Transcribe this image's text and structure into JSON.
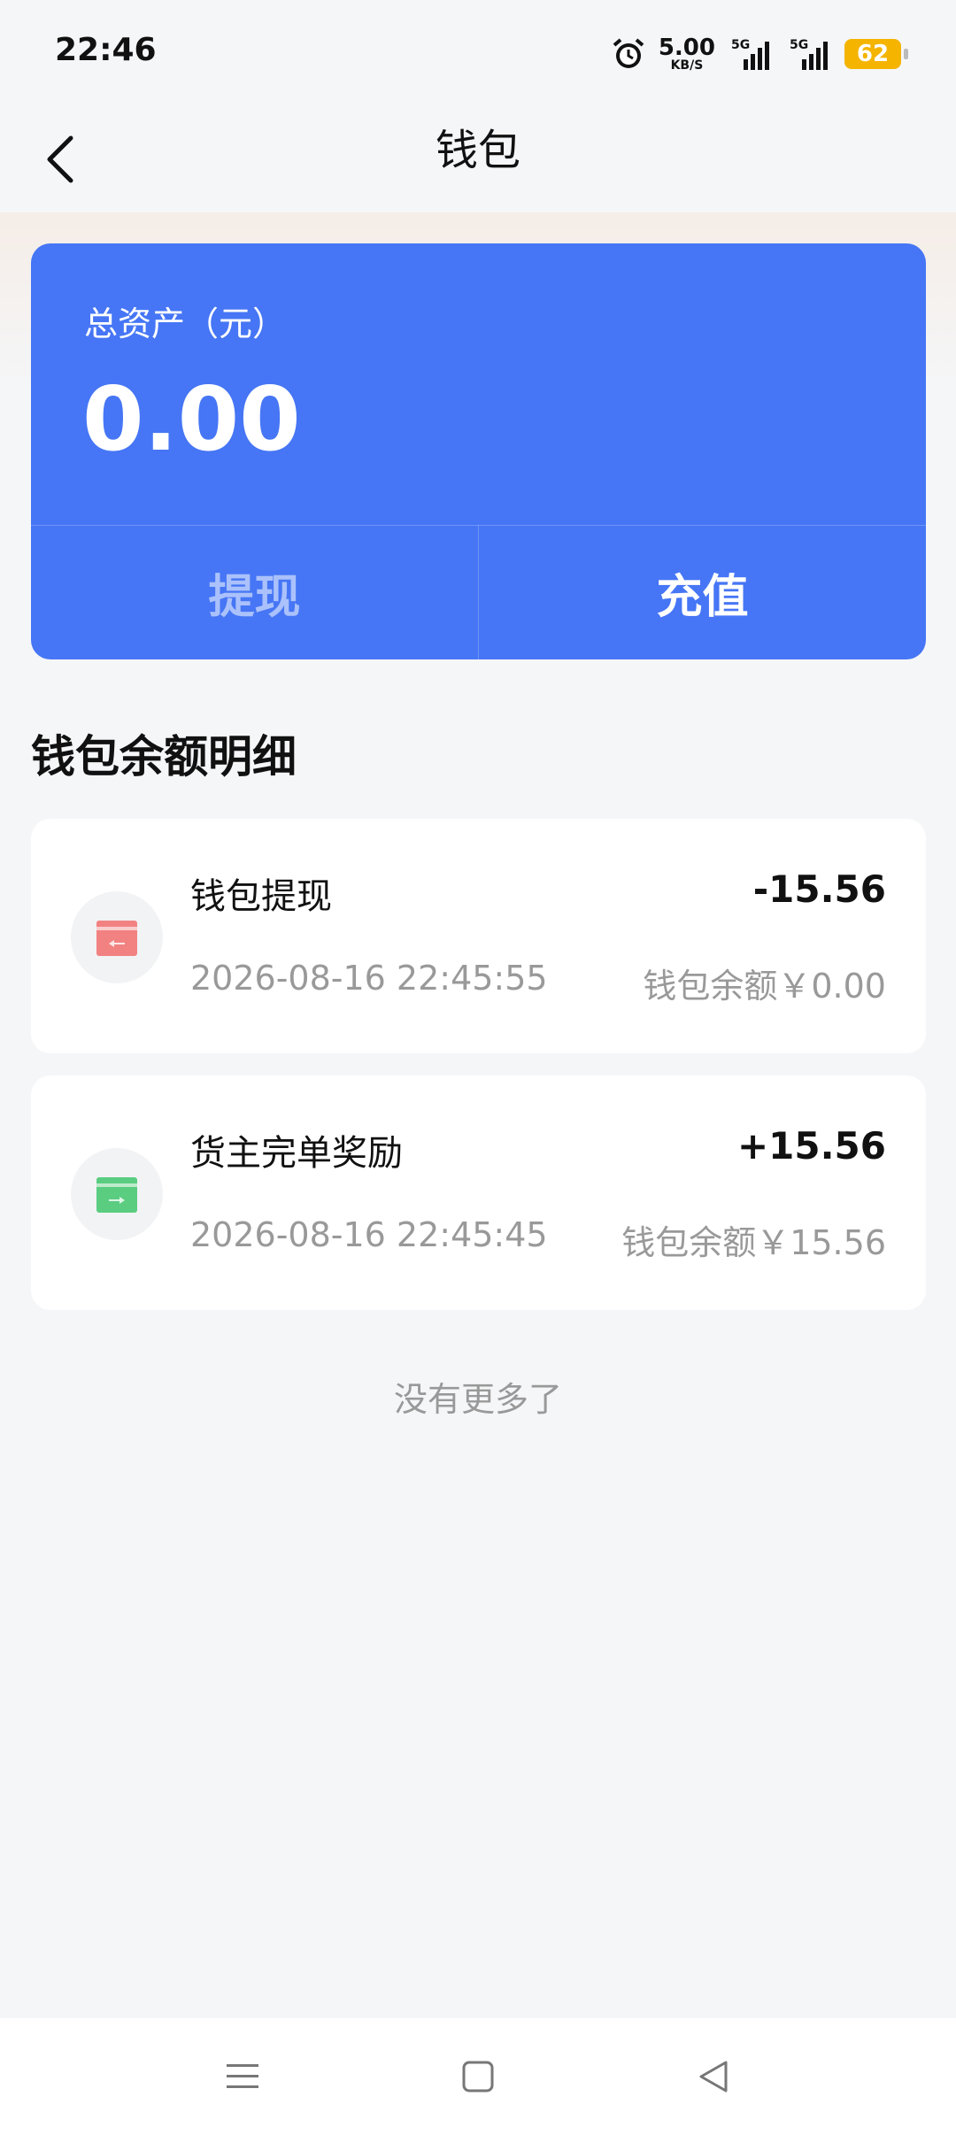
{
  "status_bar": {
    "time": "22:46",
    "net_speed_value": "5.00",
    "net_speed_unit": "KB/S",
    "signal_1_label": "5G",
    "signal_2_label": "5G",
    "battery": "62",
    "battery_color": "#F4B400"
  },
  "header": {
    "title": "钱包",
    "back_icon": "chevron-left-icon"
  },
  "asset_card": {
    "label": "总资产（元）",
    "value": "0.00",
    "withdraw_label": "提现",
    "recharge_label": "充值",
    "background_color": "#4676F5"
  },
  "details": {
    "section_title": "钱包余额明细",
    "transactions": [
      {
        "title": "钱包提现",
        "amount": "-15.56",
        "time": "2026-08-16 22:45:55",
        "balance": "钱包余额￥0.00",
        "icon": "withdraw-card-icon",
        "icon_color": "#F26D6D"
      },
      {
        "title": "货主完单奖励",
        "amount": "+15.56",
        "time": "2026-08-16 22:45:45",
        "balance": "钱包余额￥15.56",
        "icon": "reward-card-icon",
        "icon_color": "#3FC66B"
      }
    ],
    "no_more": "没有更多了"
  },
  "bottom_nav": {
    "items": [
      "menu-icon",
      "home-square-icon",
      "back-triangle-icon"
    ]
  }
}
